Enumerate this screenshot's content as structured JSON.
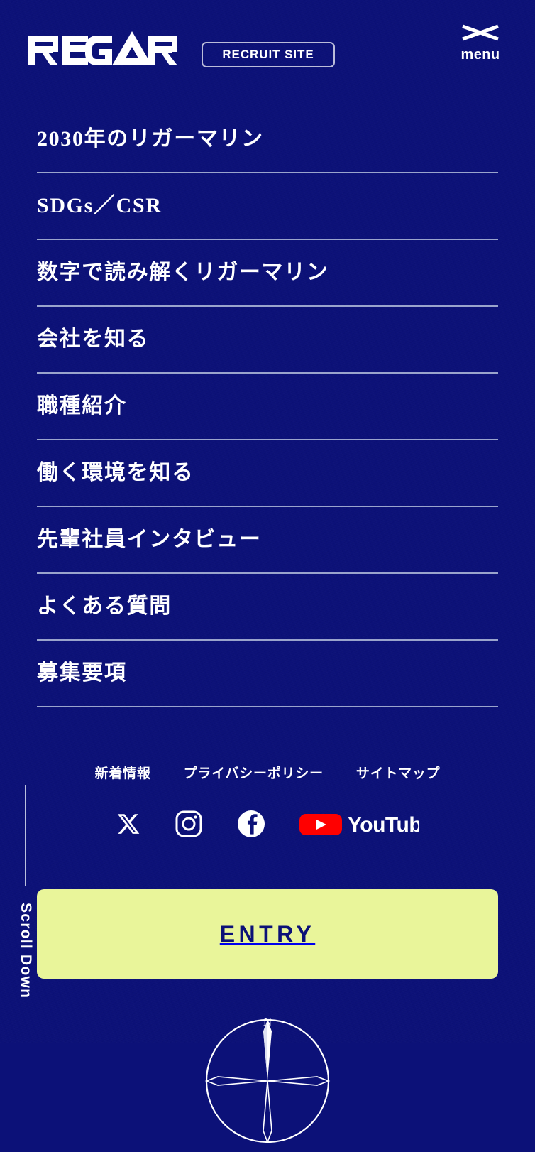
{
  "theme": {
    "background": "#0c1178",
    "text": "#ffffff",
    "divider": "#9aa4cc",
    "accent": "#e9f59a",
    "accent_text": "#0c1178",
    "youtube_red": "#ff0000"
  },
  "header": {
    "logo_text": "REGAR",
    "logo_name": "regar-logo",
    "badge_label": "RECRUIT SITE",
    "menu_label": "menu",
    "menu_icon": "close-x-icon"
  },
  "nav": {
    "items": [
      {
        "label": "2030年のリガーマリン",
        "name": "nav-item-2030-rigarmarine"
      },
      {
        "label": "SDGs／CSR",
        "name": "nav-item-sdgs-csr"
      },
      {
        "label": "数字で読み解くリガーマリン",
        "name": "nav-item-numbers"
      },
      {
        "label": "会社を知る",
        "name": "nav-item-about-company"
      },
      {
        "label": "職種紹介",
        "name": "nav-item-job-types"
      },
      {
        "label": "働く環境を知る",
        "name": "nav-item-work-environment"
      },
      {
        "label": "先輩社員インタビュー",
        "name": "nav-item-interviews"
      },
      {
        "label": "よくある質問",
        "name": "nav-item-faq"
      },
      {
        "label": "募集要項",
        "name": "nav-item-recruitment"
      }
    ]
  },
  "footer": {
    "links": [
      {
        "label": "新着情報",
        "name": "footer-link-news"
      },
      {
        "label": "プライバシーポリシー",
        "name": "footer-link-privacy-policy"
      },
      {
        "label": "サイトマップ",
        "name": "footer-link-sitemap"
      }
    ],
    "social": [
      {
        "name": "x-twitter-icon",
        "label": "X"
      },
      {
        "name": "instagram-icon",
        "label": "Instagram"
      },
      {
        "name": "facebook-icon",
        "label": "Facebook"
      },
      {
        "name": "youtube-icon",
        "label": "YouTube"
      }
    ]
  },
  "scroll": {
    "label": "Scroll Down"
  },
  "entry": {
    "label": "ENTRY"
  },
  "compass": {
    "north_label": "N"
  }
}
